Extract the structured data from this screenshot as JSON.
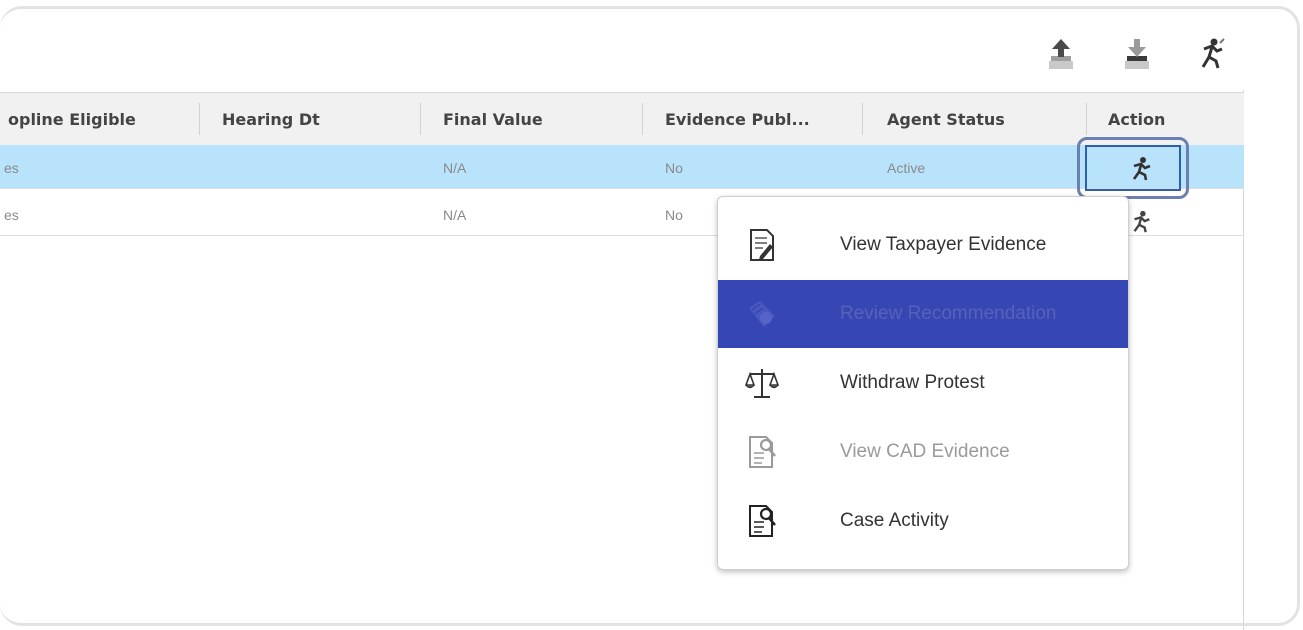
{
  "toolbar": {
    "icons": [
      "upload-icon",
      "download-icon",
      "agent-run-icon"
    ]
  },
  "grid": {
    "columns": [
      {
        "label": "opline Eligible"
      },
      {
        "label": "Hearing Dt"
      },
      {
        "label": "Final Value"
      },
      {
        "label": "Evidence Publ..."
      },
      {
        "label": "Agent Status"
      },
      {
        "label": "Action"
      }
    ],
    "rows": [
      {
        "eligible": "es",
        "hearing": "",
        "final_value": "N/A",
        "evidence": "No",
        "agent_status": "Active",
        "selected": true
      },
      {
        "eligible": "es",
        "hearing": "",
        "final_value": "N/A",
        "evidence": "No",
        "agent_status": "",
        "selected": false
      }
    ]
  },
  "action_menu": {
    "items": [
      {
        "label": "View Taxpayer Evidence",
        "icon": "document-edit-icon",
        "state": "normal"
      },
      {
        "label": "Review Recommendation",
        "icon": "recommendation-icon",
        "state": "highlighted"
      },
      {
        "label": "Withdraw Protest",
        "icon": "scales-icon",
        "state": "normal"
      },
      {
        "label": "View CAD Evidence",
        "icon": "document-search-icon",
        "state": "disabled"
      },
      {
        "label": "Case Activity",
        "icon": "document-search-icon",
        "state": "normal"
      }
    ]
  },
  "colors": {
    "selected_row": "#b9e3fb",
    "menu_highlight": "#3647b3",
    "focus_border": "#6b7fb0"
  }
}
